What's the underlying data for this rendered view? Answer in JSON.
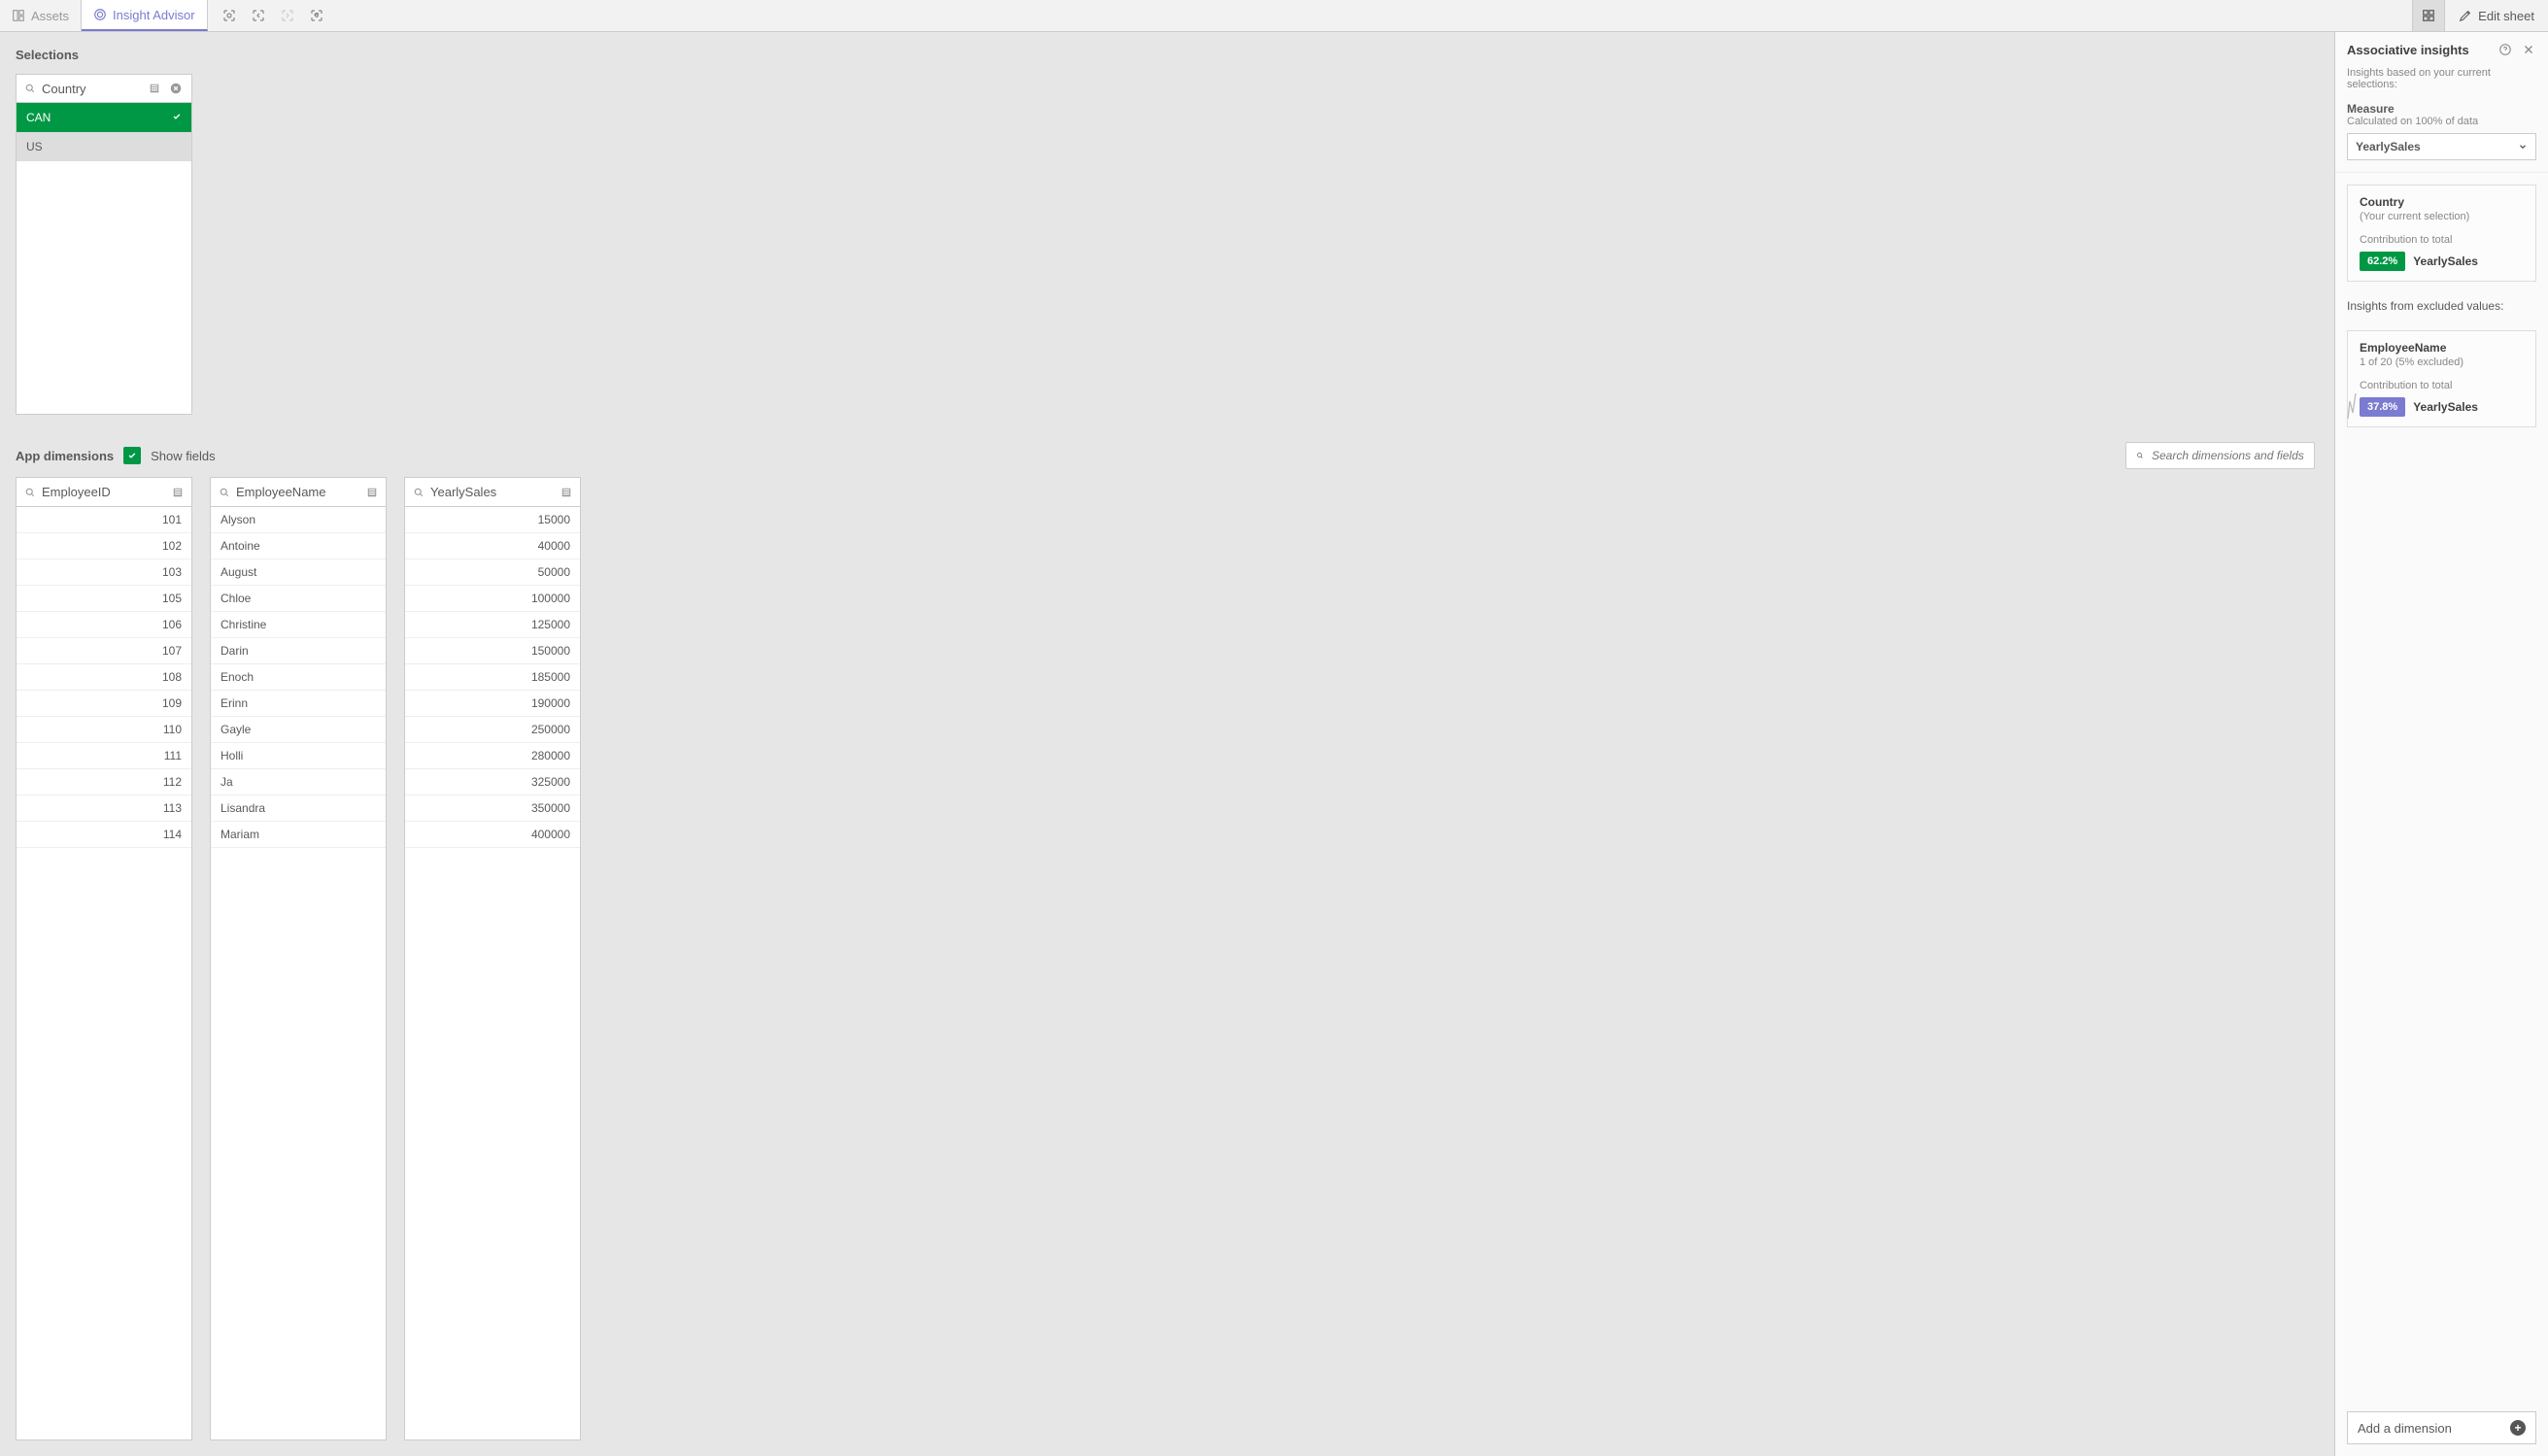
{
  "topbar": {
    "assets_label": "Assets",
    "insight_advisor_label": "Insight Advisor",
    "edit_sheet_label": "Edit sheet"
  },
  "selections": {
    "title": "Selections",
    "field_name": "Country",
    "values": [
      {
        "label": "CAN",
        "selected": true
      },
      {
        "label": "US",
        "selected": false
      }
    ]
  },
  "dimensions_bar": {
    "title": "App dimensions",
    "show_fields_label": "Show fields",
    "search_placeholder": "Search dimensions and fields"
  },
  "field_lists": [
    {
      "name": "EmployeeID",
      "align": "right",
      "values": [
        "101",
        "102",
        "103",
        "105",
        "106",
        "107",
        "108",
        "109",
        "110",
        "111",
        "112",
        "113",
        "114"
      ]
    },
    {
      "name": "EmployeeName",
      "align": "left",
      "values": [
        "Alyson",
        "Antoine",
        "August",
        "Chloe",
        "Christine",
        "Darin",
        "Enoch",
        "Erinn",
        "Gayle",
        "Holli",
        "Ja",
        "Lisandra",
        "Mariam"
      ]
    },
    {
      "name": "YearlySales",
      "align": "right",
      "values": [
        "15000",
        "40000",
        "50000",
        "100000",
        "125000",
        "150000",
        "185000",
        "190000",
        "250000",
        "280000",
        "325000",
        "350000",
        "400000"
      ]
    }
  ],
  "panel": {
    "title": "Associative insights",
    "subtitle": "Insights based on your current selections:",
    "measure_label": "Measure",
    "measure_sub": "Calculated on 100% of data",
    "measure_value": "YearlySales",
    "current_card": {
      "name": "Country",
      "sub": "(Your current selection)",
      "contr_label": "Contribution to total",
      "badge": "62.2%",
      "badge_label": "YearlySales"
    },
    "excluded_title": "Insights from excluded values:",
    "excluded_card": {
      "name": "EmployeeName",
      "sub": "1 of 20 (5% excluded)",
      "contr_label": "Contribution to total",
      "badge": "37.8%",
      "badge_label": "YearlySales"
    },
    "add_dimension_label": "Add a dimension"
  }
}
